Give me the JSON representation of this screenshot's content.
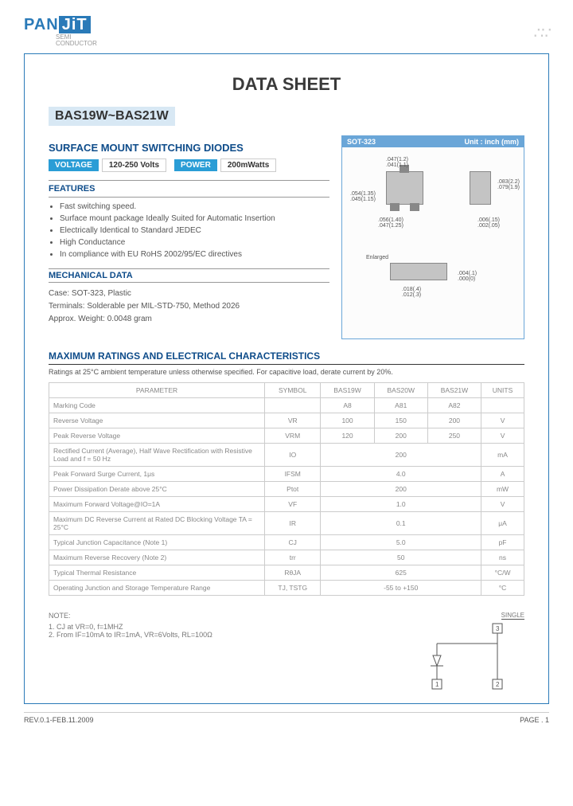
{
  "logo": {
    "part1": "PAN",
    "part2": "JiT",
    "sub1": "SEMI",
    "sub2": "CONDUCTOR"
  },
  "doc": {
    "title": "DATA  SHEET",
    "partRange": "BAS19W~BAS21W",
    "productTitle": "SURFACE MOUNT SWITCHING DIODES",
    "voltageTag": "VOLTAGE",
    "voltageVal": "120-250 Volts",
    "powerTag": "POWER",
    "powerVal": "200mWatts",
    "featuresHead": "FEATURES",
    "features": [
      "Fast switching speed.",
      "Surface mount package Ideally Suited for Automatic Insertion",
      "Electrically Identical to Standard JEDEC",
      "High Conductance",
      "In compliance with EU RoHS 2002/95/EC directives"
    ],
    "mechHead": "MECHANICAL DATA",
    "mech": [
      "Case: SOT-323, Plastic",
      "Terminals: Solderable per MIL-STD-750, Method 2026",
      "Approx. Weight: 0.0048 gram"
    ],
    "pkg": {
      "name": "SOT-323",
      "unit": "Unit : inch (mm)",
      "dims": {
        "d1": ".047(1.2)",
        "d2": ".041(1.1)",
        "d3": ".054(1.35)",
        "d4": ".045(1.15)",
        "d5": ".056(1.40)",
        "d6": ".047(1.25)",
        "d7": ".083(2.2)",
        "d8": ".079(1.9)",
        "d9": ".006(.15)",
        "d10": ".002(.05)",
        "d11": ".018(.4)",
        "d12": ".012(.3)",
        "d13": ".004(.1)",
        "d14": ".000(0)",
        "enl": "Enlarged"
      }
    },
    "maxTitle": "MAXIMUM RATINGS AND ELECTRICAL CHARACTERISTICS",
    "ratingNote": "Ratings at 25°C ambient temperature unless otherwise specified. For capacitive load, derate current by 20%.",
    "tableHead": {
      "param": "PARAMETER",
      "sym": "SYMBOL",
      "c1": "BAS19W",
      "c2": "BAS20W",
      "c3": "BAS21W",
      "unit": "UNITS"
    },
    "rows": [
      {
        "p": "Marking Code",
        "s": "",
        "v": [
          "A8",
          "A81",
          "A82"
        ],
        "u": ""
      },
      {
        "p": "Reverse Voltage",
        "s": "VR",
        "v": [
          "100",
          "150",
          "200"
        ],
        "u": "V"
      },
      {
        "p": "Peak Reverse Voltage",
        "s": "VRM",
        "v": [
          "120",
          "200",
          "250"
        ],
        "u": "V"
      },
      {
        "p": "Rectified Current (Average), Half Wave Rectification with Resistive Load and f = 50 Hz",
        "s": "IO",
        "v": [
          "",
          "200",
          ""
        ],
        "u": "mA"
      },
      {
        "p": "Peak Forward Surge Current, 1μs",
        "s": "IFSM",
        "v": [
          "",
          "4.0",
          ""
        ],
        "u": "A"
      },
      {
        "p": "Power Dissipation Derate above 25°C",
        "s": "Ptot",
        "v": [
          "",
          "200",
          ""
        ],
        "u": "mW"
      },
      {
        "p": "Maximum Forward Voltage@IO=1A",
        "s": "VF",
        "v": [
          "",
          "1.0",
          ""
        ],
        "u": "V"
      },
      {
        "p": "Maximum DC Reverse Current at Rated DC Blocking Voltage TA = 25°C",
        "s": "IR",
        "v": [
          "",
          "0.1",
          ""
        ],
        "u": "μA"
      },
      {
        "p": "Typical Junction Capacitance (Note 1)",
        "s": "CJ",
        "v": [
          "",
          "5.0",
          ""
        ],
        "u": "pF"
      },
      {
        "p": "Maximum Reverse Recovery (Note 2)",
        "s": "trr",
        "v": [
          "",
          "50",
          ""
        ],
        "u": "ns"
      },
      {
        "p": "Typical Thermal Resistance",
        "s": "RθJA",
        "v": [
          "",
          "625",
          ""
        ],
        "u": "°C/W"
      },
      {
        "p": "Operating Junction and Storage Temperature Range",
        "s": "TJ, TSTG",
        "v": [
          "",
          "-55 to +150",
          ""
        ],
        "u": "°C"
      }
    ],
    "notesHead": "NOTE:",
    "notes": [
      "1. CJ at VR=0, f=1MHZ",
      "2. From IF=10mA to IR=1mA, VR=6Volts, RL=100Ω"
    ],
    "schematic": {
      "label": "SINGLE",
      "pin1": "1",
      "pin2": "2",
      "pin3": "3"
    },
    "footer": {
      "rev": "REV.0.1-FEB.11.2009",
      "page": "PAGE . 1"
    }
  }
}
